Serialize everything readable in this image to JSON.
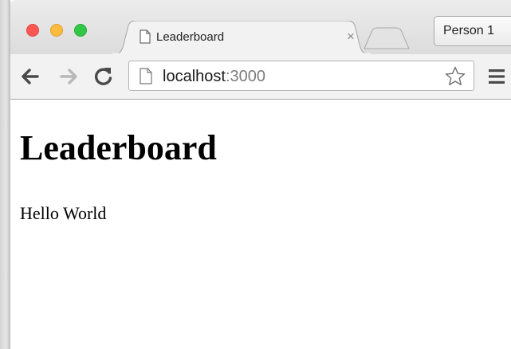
{
  "window": {
    "traffic_lights": {
      "close_color": "#fc5753",
      "minimize_color": "#fdbc40",
      "maximize_color": "#33c748"
    }
  },
  "tabs": [
    {
      "title": "Leaderboard",
      "icon": "page-icon",
      "active": true
    }
  ],
  "tab_close_glyph": "×",
  "profile": {
    "label": "Person 1"
  },
  "toolbar": {
    "back_icon": "back-arrow-icon",
    "forward_icon": "forward-arrow-icon",
    "reload_icon": "reload-icon",
    "bookmark_icon": "star-icon",
    "menu_icon": "hamburger-menu-icon"
  },
  "address_bar": {
    "host": "localhost",
    "port": ":3000"
  },
  "page": {
    "heading": "Leaderboard",
    "body_text": "Hello World"
  }
}
